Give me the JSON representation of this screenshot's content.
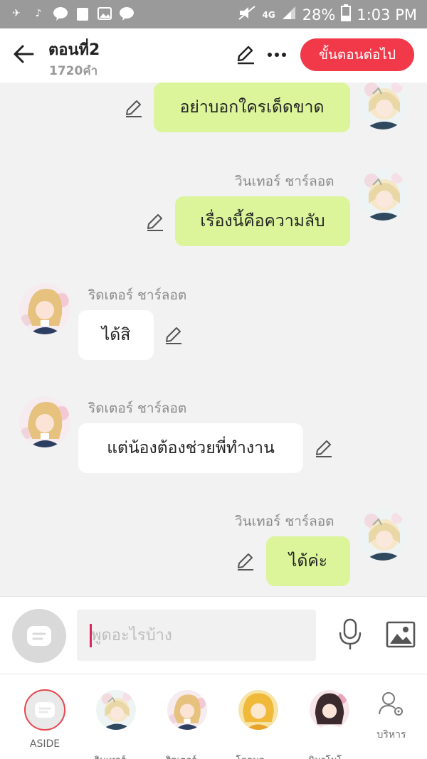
{
  "status_bar": {
    "network": "4G",
    "battery": "28%",
    "time": "1:03 PM"
  },
  "header": {
    "title": "ตอนที่2",
    "subtitle": "1720คำ",
    "next_button": "ขั้นตอนต่อไป"
  },
  "messages": [
    {
      "side": "right",
      "name": "",
      "text": "อย่าบอกใครเด็ดขาด"
    },
    {
      "side": "right",
      "name": "วินเทอร์ ชาร์ลอต",
      "text": "เรื่องนี้คือความลับ"
    },
    {
      "side": "left",
      "name": "ริดเตอร์ ชาร์ลอต",
      "text": "ได้สิ"
    },
    {
      "side": "left",
      "name": "ริดเตอร์ ชาร์ลอต",
      "text": "แต่น้องต้องช่วยพี่ทำงาน"
    },
    {
      "side": "right",
      "name": "วินเทอร์ ชาร์ลอต",
      "text": "ได้ค่ะ"
    }
  ],
  "input": {
    "placeholder": "พูดอะไรบ้าง"
  },
  "bottom_bar": {
    "aside_label": "ASIDE",
    "characters": [
      {
        "label": "วินเทอร์ ..."
      },
      {
        "label": "ริดเตอร์ ..."
      },
      {
        "label": "โฮคุมุระ ..."
      },
      {
        "label": "มินาโมโ..."
      }
    ],
    "manage_label": "บริหาร"
  },
  "colors": {
    "accent": "#f2394a",
    "my_bubble": "#dcf59a",
    "their_bubble": "#ffffff",
    "background": "#f2f2f2"
  }
}
